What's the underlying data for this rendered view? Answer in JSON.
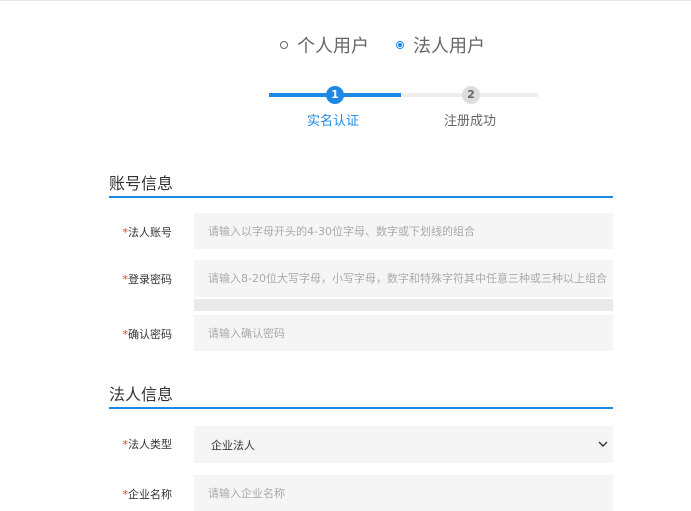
{
  "user_type": {
    "options": [
      {
        "label": "个人用户",
        "selected": false
      },
      {
        "label": "法人用户",
        "selected": true
      }
    ]
  },
  "steps": [
    {
      "number": "1",
      "label": "实名认证",
      "active": true
    },
    {
      "number": "2",
      "label": "注册成功",
      "active": false
    }
  ],
  "account_section": {
    "title": "账号信息",
    "fields": {
      "account": {
        "required": "*",
        "label": "法人账号",
        "placeholder": "请输入以字母开头的4-30位字母、数字或下划线的组合"
      },
      "password": {
        "required": "*",
        "label": "登录密码",
        "placeholder": "请输入8-20位大写字母，小写字母，数字和特殊字符其中任意三种或三种以上组合"
      },
      "confirm": {
        "required": "*",
        "label": "确认密码",
        "placeholder": "请输入确认密码"
      }
    }
  },
  "legal_section": {
    "title": "法人信息",
    "fields": {
      "type": {
        "required": "*",
        "label": "法人类型",
        "value": "企业法人"
      },
      "company_name": {
        "required": "*",
        "label": "企业名称",
        "placeholder": "请输入企业名称"
      }
    }
  },
  "colors": {
    "accent": "#1e88e5",
    "required": "#e53935",
    "input_bg": "#f5f5f5"
  },
  "icons": {
    "select_chevron": "chevron-down-icon"
  }
}
